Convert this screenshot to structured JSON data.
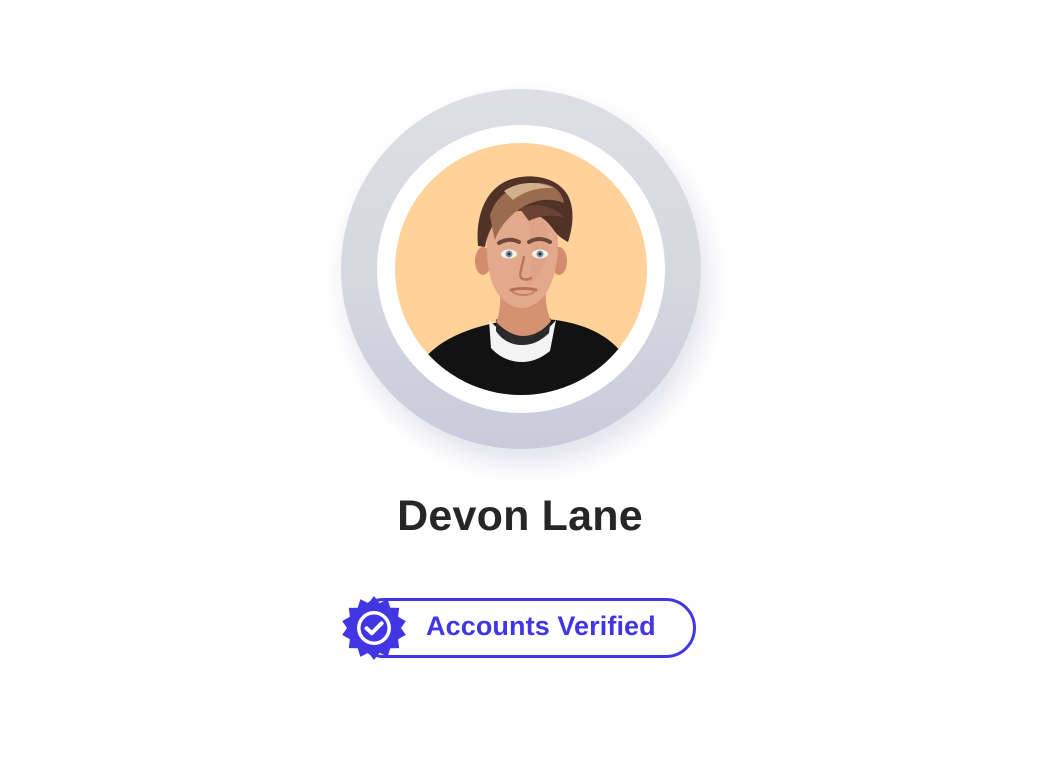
{
  "profile": {
    "name": "Devon Lane",
    "avatar_description": "portrait photo on a peach circular background",
    "avatar_background_color": "#ffd29a"
  },
  "verification": {
    "label": "Accounts Verified",
    "icon": "verified-badge-icon",
    "accent_color": "#4136e2"
  }
}
